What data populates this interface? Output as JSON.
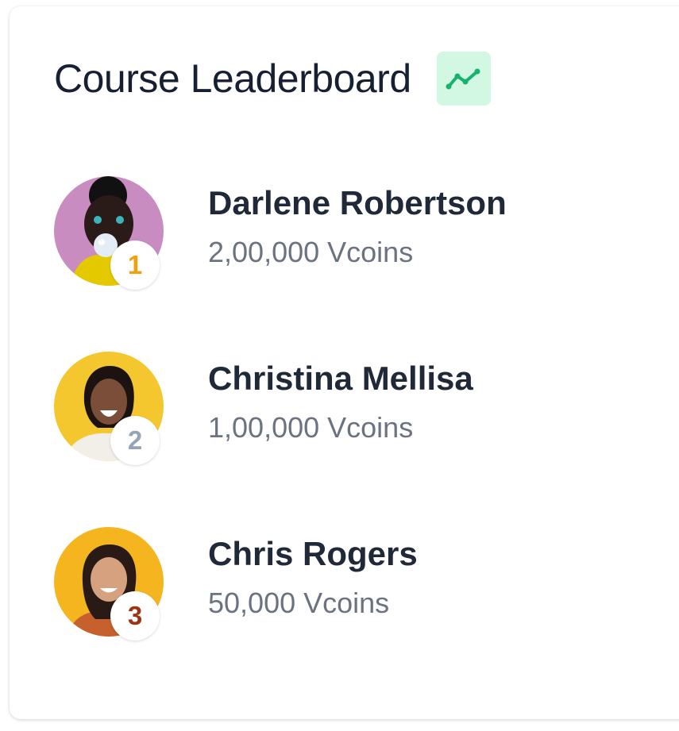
{
  "header": {
    "title": "Course Leaderboard",
    "trend_icon": "trend-line-icon",
    "trend_icon_color": "#17b36b",
    "trend_badge_bg": "#d2f7e3"
  },
  "leaders": [
    {
      "rank": "1",
      "name": "Darlene Robertson",
      "coins": "2,00,000 Vcoins",
      "rank_color": "#f59e0b"
    },
    {
      "rank": "2",
      "name": "Christina Mellisa",
      "coins": "1,00,000 Vcoins",
      "rank_color": "#94a3b8"
    },
    {
      "rank": "3",
      "name": "Chris Rogers",
      "coins": "50,000 Vcoins",
      "rank_color": "#9a3412"
    }
  ]
}
